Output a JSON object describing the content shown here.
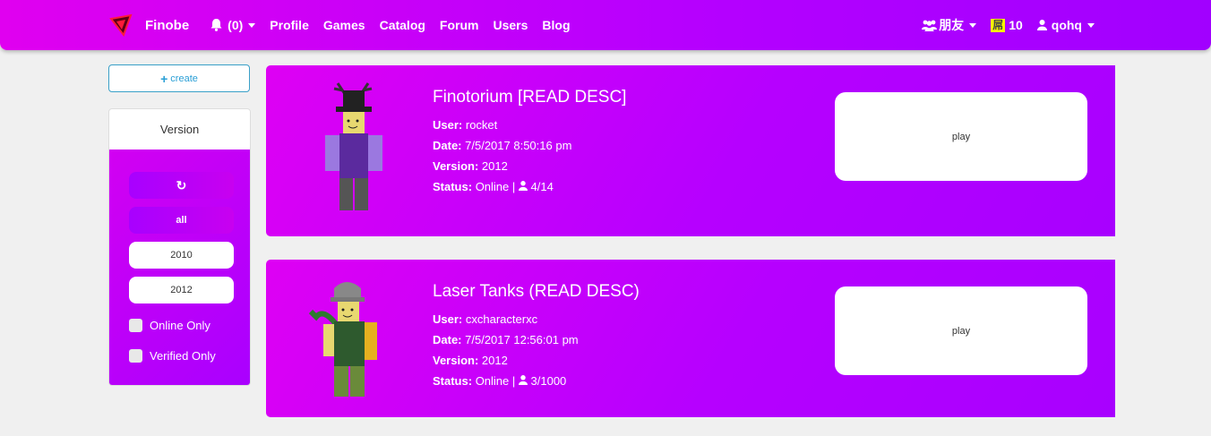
{
  "navbar": {
    "brand": "Finobe",
    "notifications": "(0)",
    "links": [
      "Profile",
      "Games",
      "Catalog",
      "Forum",
      "Users",
      "Blog"
    ],
    "friends_label": "朋友",
    "currency_icon": "屌",
    "currency_value": "10",
    "username": "qohq"
  },
  "sidebar": {
    "create_label": "create",
    "version_heading": "Version",
    "refresh_icon": "↻",
    "all_label": "all",
    "versions": [
      "2010",
      "2012"
    ],
    "online_only_label": "Online Only",
    "verified_only_label": "Verified Only"
  },
  "games": [
    {
      "title": "Finotorium [READ DESC]",
      "user_label": "User:",
      "user": "rocket",
      "date_label": "Date:",
      "date": "7/5/2017 8:50:16 pm",
      "version_label": "Version:",
      "version": "2012",
      "status_label": "Status:",
      "status": "Online |",
      "players": "4/14",
      "play_label": "play"
    },
    {
      "title": "Laser Tanks (READ DESC)",
      "user_label": "User:",
      "user": "cxcharacterxc",
      "date_label": "Date:",
      "date": "7/5/2017 12:56:01 pm",
      "version_label": "Version:",
      "version": "2012",
      "status_label": "Status:",
      "status": "Online |",
      "players": "3/1000",
      "play_label": "play"
    }
  ],
  "colors": {
    "accent": "#b400ff",
    "accent_pink": "#e000f0",
    "create_border": "#3aa0c8"
  }
}
